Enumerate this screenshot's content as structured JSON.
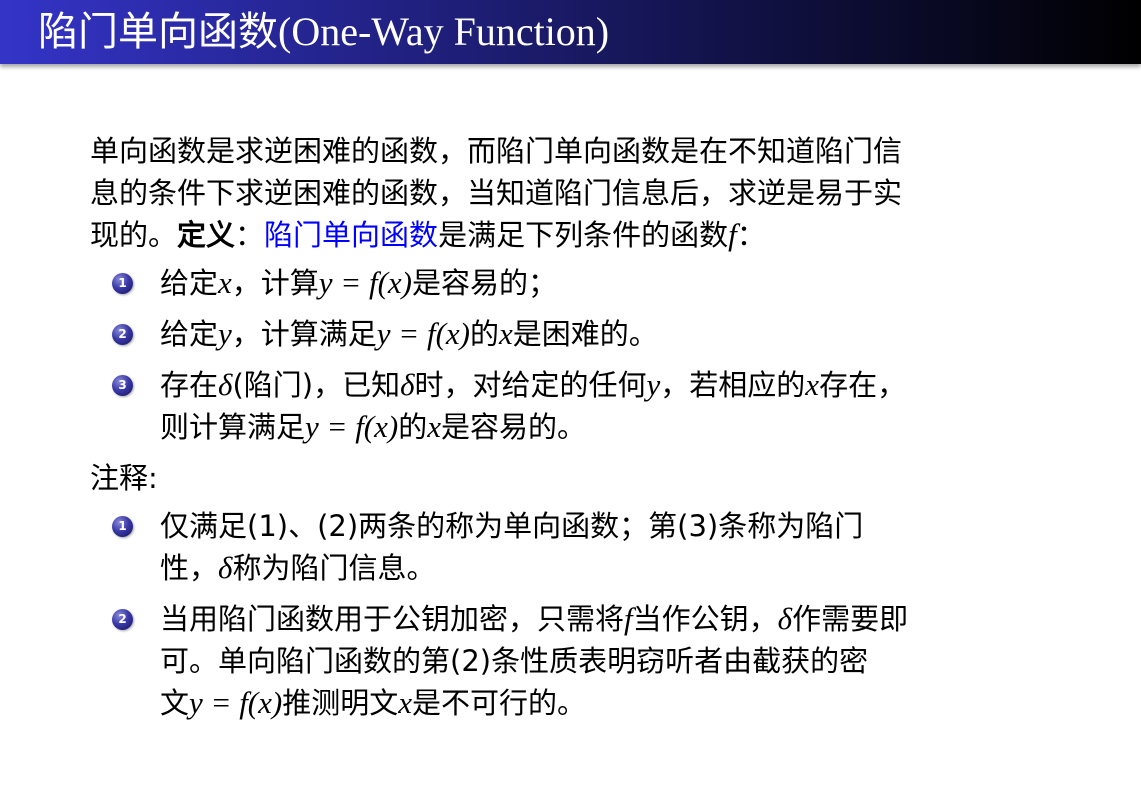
{
  "header": {
    "title": "陷门单向函数(One-Way Function)"
  },
  "intro": {
    "line1": "单向函数是求逆困难的函数，而陷门单向函数是在不知道陷门信",
    "line2": "息的条件下求逆困难的函数，当知道陷门信息后，求逆是易于实",
    "line3_a": "现的。",
    "line3_def": "定义",
    "line3_colon": "：",
    "line3_term": "陷门单向函数",
    "line3_b": "是满足下列条件的函数",
    "line3_f": "f",
    "line3_end": "："
  },
  "conditions": [
    {
      "num": "1",
      "t1": "给定",
      "m1": "x",
      "t2": "，计算",
      "m2": "y = f(x)",
      "t3": "是容易的；"
    },
    {
      "num": "2",
      "t1": "给定",
      "m1": "y",
      "t2": "，计算满足",
      "m2": "y = f(x)",
      "t3": "的",
      "m3": "x",
      "t4": "是困难的。"
    },
    {
      "num": "3",
      "t1": "存在",
      "m1": "δ",
      "t2": "(陷门)，已知",
      "m2": "δ",
      "t3": "时，对给定的任何",
      "m3": "y",
      "t4": "，若相应的",
      "m4": "x",
      "t5": "存在，",
      "l2_t1": "则计算满足",
      "l2_m1": "y = f(x)",
      "l2_t2": "的",
      "l2_m2": "x",
      "l2_t3": "是容易的。"
    }
  ],
  "notes": {
    "title": "注释:",
    "items": [
      {
        "num": "1",
        "l1": "仅满足(1)、(2)两条的称为单向函数；第(3)条称为陷门",
        "l2_t1": "性，",
        "l2_m1": "δ",
        "l2_t2": "称为陷门信息。"
      },
      {
        "num": "2",
        "l1_t1": "当用陷门函数用于公钥加密，只需将",
        "l1_m1": "f",
        "l1_t2": "当作公钥，",
        "l1_m2": "δ",
        "l1_t3": "作需要即",
        "l2": "可。单向陷门函数的第(2)条性质表明窃听者由截获的密",
        "l3_t1": "文",
        "l3_m1": "y = f(x)",
        "l3_t2": "推测明文",
        "l3_m2": "x",
        "l3_t3": "是不可行的。"
      }
    ]
  }
}
